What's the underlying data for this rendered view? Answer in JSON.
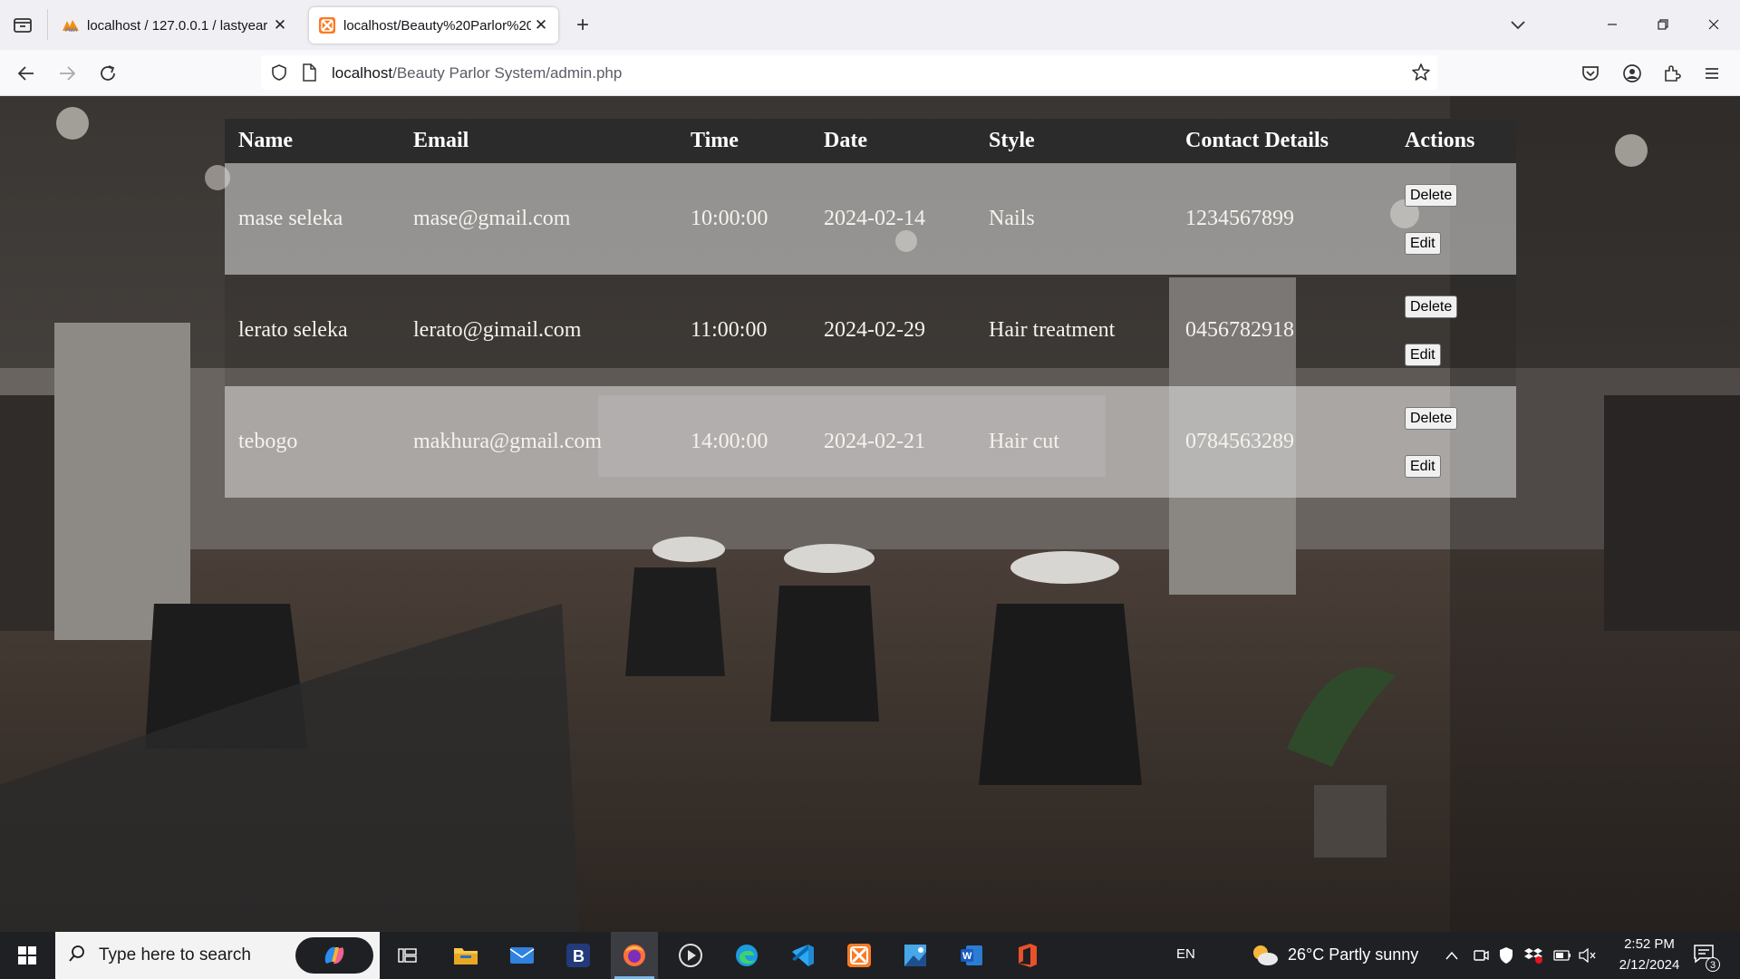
{
  "browser": {
    "tabs": [
      {
        "title": "localhost / 127.0.0.1 / lastyear /",
        "favicon": "phpmyadmin-icon",
        "active": false
      },
      {
        "title": "localhost/Beauty%20Parlor%20",
        "favicon": "xampp-icon",
        "active": true
      }
    ],
    "new_tab_label": "+",
    "url_host": "localhost",
    "url_path": "/Beauty Parlor System/admin.php"
  },
  "table": {
    "headers": [
      "Name",
      "Email",
      "Time",
      "Date",
      "Style",
      "Contact Details",
      "Actions"
    ],
    "rows": [
      {
        "name": "mase seleka",
        "email": "mase@gmail.com",
        "time": "10:00:00",
        "date": "2024-02-14",
        "style": "Nails",
        "contact": "1234567899",
        "delete_label": "Delete",
        "edit_label": "Edit"
      },
      {
        "name": "lerato seleka",
        "email": "lerato@gimail.com",
        "time": "11:00:00",
        "date": "2024-02-29",
        "style": "Hair treatment",
        "contact": "0456782918",
        "delete_label": "Delete",
        "edit_label": "Edit"
      },
      {
        "name": "tebogo",
        "email": "makhura@gmail.com",
        "time": "14:00:00",
        "date": "2024-02-21",
        "style": "Hair cut",
        "contact": "0784563289",
        "delete_label": "Delete",
        "edit_label": "Edit"
      }
    ]
  },
  "taskbar": {
    "search_placeholder": "Type here to search",
    "apps": [
      "file-explorer-icon",
      "mail-icon",
      "b-app-icon",
      "firefox-icon",
      "media-player-icon",
      "edge-icon",
      "vscode-icon",
      "xampp-icon",
      "paint-icon",
      "word-icon",
      "office-icon"
    ],
    "language": "EN",
    "weather": "26°C  Partly sunny",
    "time": "2:52 PM",
    "date": "2/12/2024",
    "notification_count": "3"
  },
  "colors": {
    "accent": "#76b9ed",
    "table_header": "#2b2b2b",
    "taskbar": "#1f2024"
  }
}
